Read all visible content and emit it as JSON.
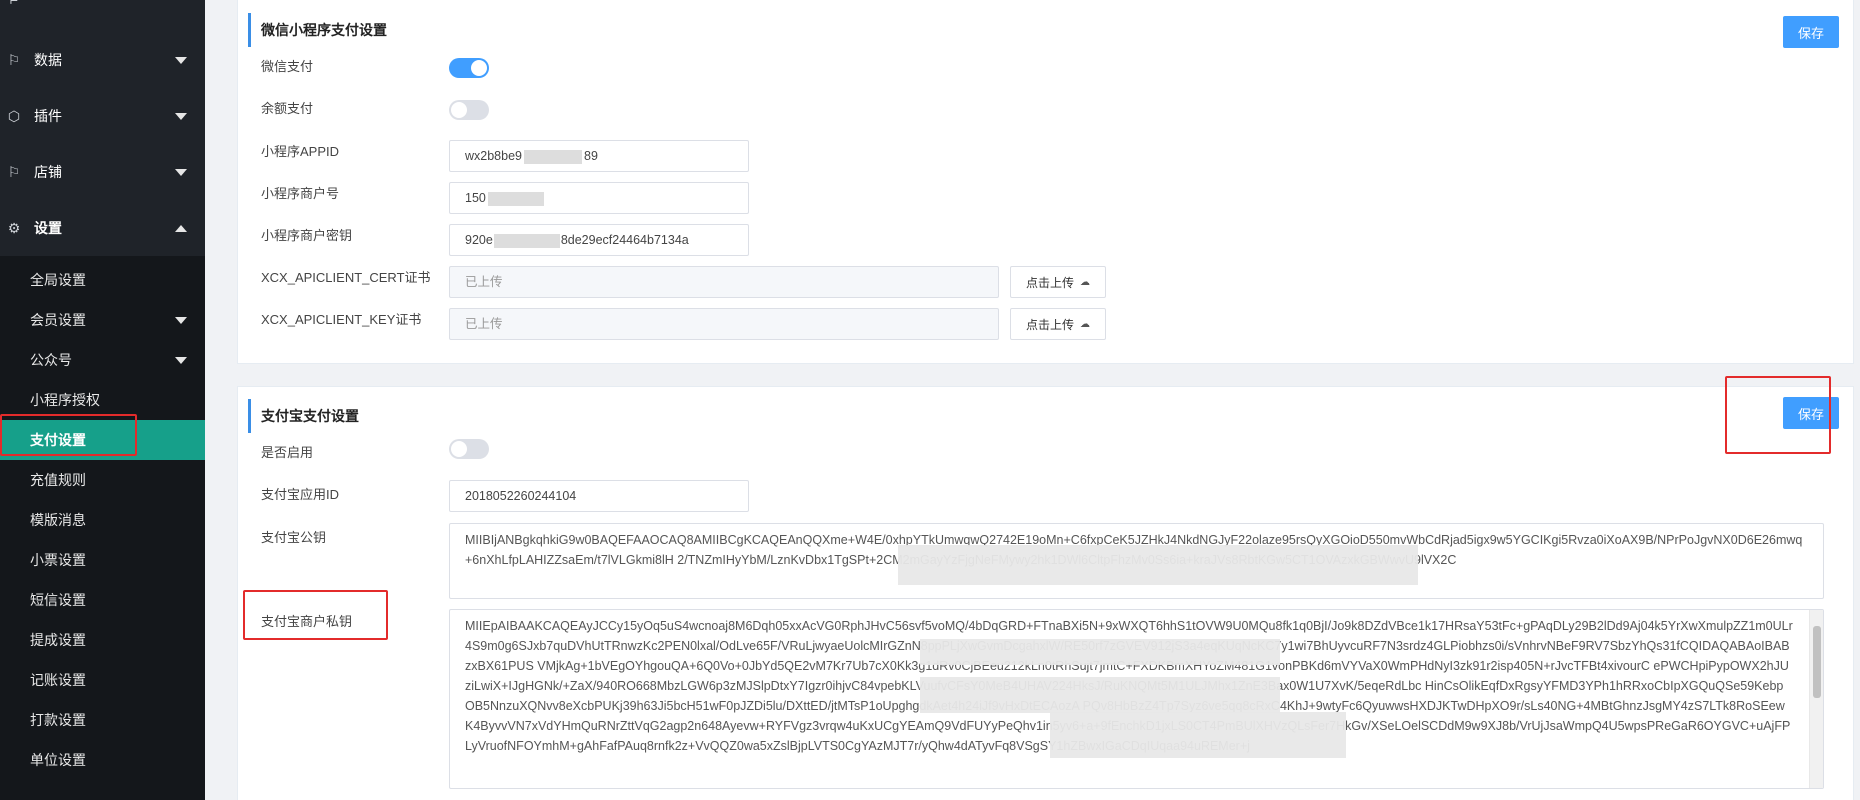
{
  "sidebar": {
    "top_items": [
      {
        "label": "数据",
        "icon": "flag-icon"
      },
      {
        "label": "插件",
        "icon": "cube-icon"
      },
      {
        "label": "店铺",
        "icon": "flag-icon"
      },
      {
        "label": "设置",
        "icon": "gear-icon"
      }
    ],
    "sub_items": [
      {
        "label": "全局设置",
        "has_caret": false
      },
      {
        "label": "会员设置",
        "has_caret": true
      },
      {
        "label": "公众号",
        "has_caret": true
      },
      {
        "label": "小程序授权",
        "has_caret": false
      },
      {
        "label": "支付设置",
        "active": true
      },
      {
        "label": "充值规则"
      },
      {
        "label": "模版消息"
      },
      {
        "label": "小票设置"
      },
      {
        "label": "短信设置"
      },
      {
        "label": "提成设置"
      },
      {
        "label": "记账设置"
      },
      {
        "label": "打款设置"
      },
      {
        "label": "单位设置"
      }
    ]
  },
  "wechat": {
    "title": "微信小程序支付设置",
    "save_label": "保存",
    "wechat_pay_label": "微信支付",
    "wechat_pay_enabled": true,
    "balance_pay_label": "余额支付",
    "balance_pay_enabled": false,
    "appid_label": "小程序APPID",
    "appid_value": "wx2b8be9",
    "appid_value_tail": "89",
    "merchant_no_label": "小程序商户号",
    "merchant_no_value": "150",
    "merchant_key_label": "小程序商户密钥",
    "merchant_key_value": "920e",
    "merchant_key_value_tail": "8de29ecf24464b7134a",
    "cert_label": "XCX_APICLIENT_CERT证书",
    "cert_value": "已上传",
    "key_label": "XCX_APICLIENT_KEY证书",
    "key_value": "已上传",
    "upload_label": "点击上传"
  },
  "alipay": {
    "title": "支付宝支付设置",
    "save_label": "保存",
    "enabled_label": "是否启用",
    "enabled": false,
    "appid_label": "支付宝应用ID",
    "appid_value": "2018052260244104",
    "public_key_label": "支付宝公钥",
    "public_key_value": "MIIBIjANBgkqhkiG9w0BAQEFAAOCAQ8AMIIBCgKCAQEAnQQXme+W4E/0xhpYTkUmwqwQ2742E19oMn+C6fxpCeK5JZHkJ4NkdNGJyF22olaze95rsQyXGOioD550mvWbCdRjad5igx9w5YGCIKgi5Rvza0iXoAX9B/NPrPoJgvNX0D6E26mwq+6nXhLfpLAHIZZsaEm/t7lVLGkmi8lH                                                                                                    2/TNZmIHyYbM/LznKvDbx1TgSPt+2CM2mGayYzFjgNeFMywy2hk1DWl6CltpFhzMv0Ss6ia+kraJVs8RbtKGw5CT1OVAzxkGBWwvU9lVX2C",
    "private_key_label": "支付宝商户私钥",
    "private_key_value": "MIIEpAIBAAKCAQEAyJCCy15yOq5uS4wcnoaj8M6Dqh05xxAcVG0RphJHvC56svf5voMQ/4bDqGRD+FTnaBXi5N+9xWXQT6hhS1tOVW9U0MQu8fk1q0BjI/Jo9k8DZdVBce1k17HRsaY53tFc+gPAqDLy29B2lDd9Aj04k5YrXwXmulpZZ1m0ULr4S9m0g6SJxb7quDVhUtTRnwzKc2PEN0lxal/OdLve65F/VRuLjwyaeUolcMIrGZnN8ppPLjXwGvmDcgahxlW/RE50rf7zGVEV912jS3a4eqKUqNcKC7y1wi7BhUyvcuRF7N3srdz4GLPiobhzs0i/sVnhrvNBeF9RV7SbzYhQs31fCQIDAQABAoIBABzxBX61PUS                   VMjkAg+1bVEgOYhgouQA+6Q0Vo+0JbYd5QE2vM7Kr7Ub7cX0Kk3g1dRv0CjBEeu212kLn0tRhSujt7jmtC+FXDKBmXHYoZM481G1vonPBKd6mVYVaX0WmPHdNyI3zk91r2isp405N+rJvcTFBt4xivourC                   ePWCHpiPypOWX2hJUziLwiX+IJgHGNk/+ZaX/940RO668MbzLGW6p3zMJSlpDtxY7Igzr0ihjvC84vpebKLVuufvCFsY0MeB4UHAV224HksJ/RuKNQMt5M1ULJMhx1ZnE3Bax0W1U7XvK/5eqeRdLbc                   HinCsOlikEqfDxRgsyYFMD3YPh1hRRxoCbIpXGQuQSe59KebpOB5NnzuXQNvv8eXcbPUKj39h63Ji5bcH51wF0pJZDi5lu/DXttED/jtMTsP1oUpghgdkAet4h24iJf9vHxDtECAozA                   PQv8HbBzZ4Tp7Syz6ve5qq8cRxC4KhJ+9wtyFc6QyuwwsHXDJKTwDHpXO9r/sLs40NG+4MBtGhnzJsgMY4zS7LTk8RoSEewK4ByvvVN7xVdYHmQuRNrZttVqG2agp2n648Ayevw+RYFVgz3vrqw4uKxUCgYEAmQ9VdFUYyPeQhv1in5yv6+a+9fEnchkD1jxLS0CT4PmBUlXHVzQLsFer7HkGv/XSeLOelSCDdM9w9XJ8b/VrUjJsaWmpQ4U5wpsPReGaR6OYGVC+uAjFPLyVruofNFOYmhM+gAhFafPAuq8rnfk2z+VvQQZ0wa5xZslBjpLVTS0CgYAzMJT7r/yQhw4dATyvFq8VSgSY1hZBwxIGaCDqIUqaa94uREMer+j"
  }
}
